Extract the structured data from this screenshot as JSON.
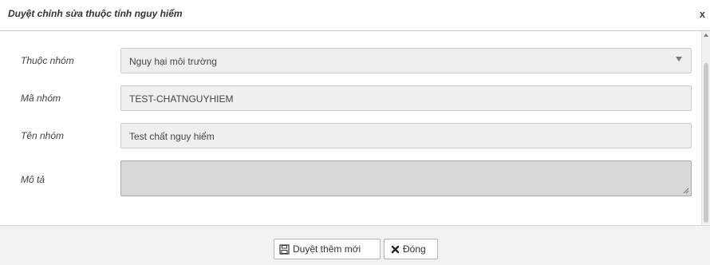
{
  "dialog": {
    "title": "Duyệt chỉnh sửa thuộc tính nguy hiểm",
    "close_symbol": "x"
  },
  "form": {
    "group": {
      "label": "Thuộc nhóm",
      "value": "Nguy hại môi trường"
    },
    "code": {
      "label": "Mã nhóm",
      "value": "TEST-CHATNGUYHIEM"
    },
    "name": {
      "label": "Tên nhóm",
      "value": "Test chất nguy hiểm"
    },
    "description": {
      "label": "Mô tả",
      "value": ""
    }
  },
  "footer": {
    "approve_label": "Duyệt thêm mới",
    "approve_icon": "save-icon",
    "close_label": "Đóng",
    "close_icon": "close-icon"
  }
}
